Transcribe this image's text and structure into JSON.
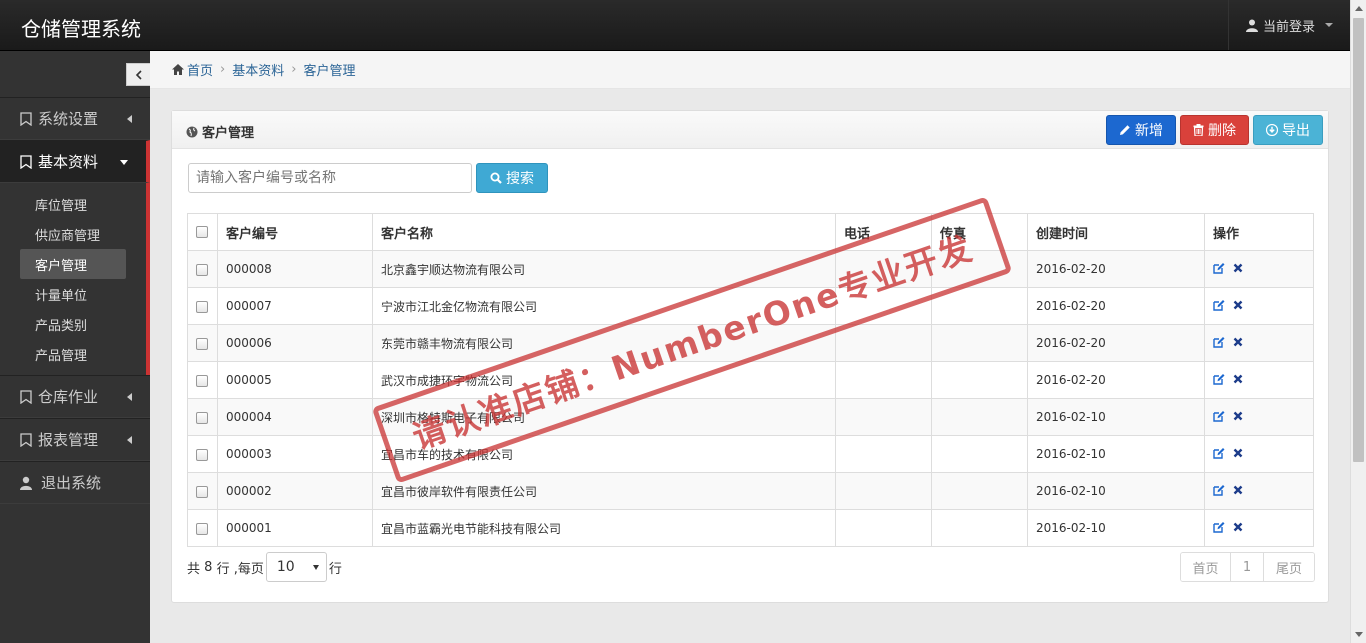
{
  "app": {
    "title": "仓储管理系统",
    "user_menu": "当前登录"
  },
  "sidebar": {
    "collapse_icon": "chevron-left-icon",
    "menu": [
      {
        "label": "系统设置",
        "icon": "bookmark-icon",
        "open": false
      },
      {
        "label": "基本资料",
        "icon": "bookmark-icon",
        "open": true
      },
      {
        "label": "仓库作业",
        "icon": "bookmark-icon",
        "open": false
      },
      {
        "label": "报表管理",
        "icon": "bookmark-icon",
        "open": false
      },
      {
        "label": "退出系统",
        "icon": "user-icon",
        "open": false
      }
    ],
    "submenu": [
      "库位管理",
      "供应商管理",
      "客户管理",
      "计量单位",
      "产品类别",
      "产品管理"
    ],
    "active_sub": "客户管理"
  },
  "breadcrumb": [
    "首页",
    "基本资料",
    "客户管理"
  ],
  "panel": {
    "title": "客户管理",
    "buttons": {
      "new": "新增",
      "delete": "删除",
      "export": "导出"
    }
  },
  "search": {
    "placeholder": "请输入客户编号或名称",
    "button": "搜索"
  },
  "table": {
    "columns": [
      "客户编号",
      "客户名称",
      "电话",
      "传真",
      "创建时间",
      "操作"
    ],
    "rows": [
      {
        "code": "000008",
        "name": "北京鑫宇顺达物流有限公司",
        "phone": "",
        "fax": "",
        "created": "2016-02-20"
      },
      {
        "code": "000007",
        "name": "宁波市江北金亿物流有限公司",
        "phone": "",
        "fax": "",
        "created": "2016-02-20"
      },
      {
        "code": "000006",
        "name": "东莞市赣丰物流有限公司",
        "phone": "",
        "fax": "",
        "created": "2016-02-20"
      },
      {
        "code": "000005",
        "name": "武汉市成捷环宇物流公司",
        "phone": "",
        "fax": "",
        "created": "2016-02-20"
      },
      {
        "code": "000004",
        "name": "深圳市格特斯电子有限公司",
        "phone": "",
        "fax": "",
        "created": "2016-02-10"
      },
      {
        "code": "000003",
        "name": "宜昌市车的技术有限公司",
        "phone": "",
        "fax": "",
        "created": "2016-02-10"
      },
      {
        "code": "000002",
        "name": "宜昌市彼岸软件有限责任公司",
        "phone": "",
        "fax": "",
        "created": "2016-02-10"
      },
      {
        "code": "000001",
        "name": "宜昌市蓝霸光电节能科技有限公司",
        "phone": "",
        "fax": "",
        "created": "2016-02-10"
      }
    ]
  },
  "footer": {
    "total_prefix": "共",
    "total": "8",
    "total_suffix": "行 ,每页",
    "page_size": "10",
    "page_size_suffix": "行",
    "pager": [
      "首页",
      "1",
      "尾页"
    ]
  },
  "watermark": {
    "text": "请认准店铺：NumberOne专业开发"
  },
  "colors": {
    "primary": "#1c68d0",
    "danger": "#d9413b",
    "info": "#4bb3d6",
    "sidebar": "#333333",
    "accent": "#cc3333"
  }
}
